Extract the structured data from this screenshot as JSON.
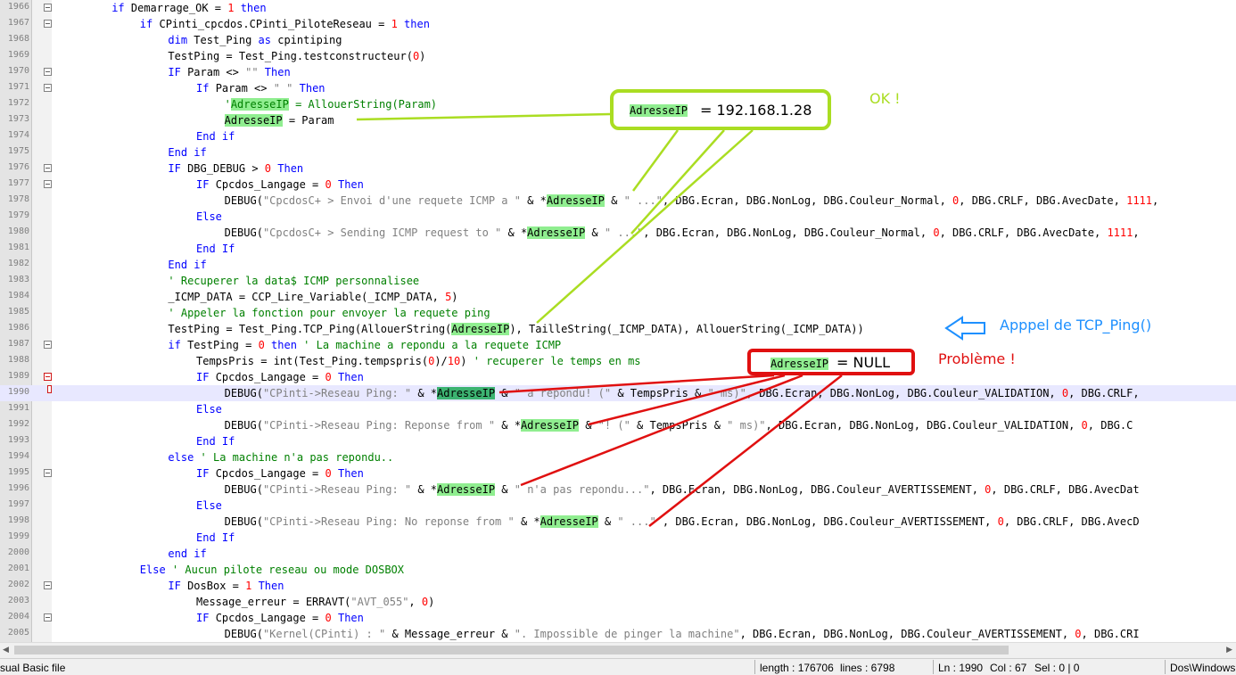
{
  "editor": {
    "lines": [
      {
        "num": "1966",
        "indent": 8,
        "fold": "open",
        "parts": [
          [
            "kw",
            "if "
          ],
          [
            "",
            "Demarrage_OK = "
          ],
          [
            "num",
            "1"
          ],
          [
            "kw",
            " then"
          ]
        ]
      },
      {
        "num": "1967",
        "indent": 12,
        "fold": "open",
        "parts": [
          [
            "kw",
            "if "
          ],
          [
            "",
            "CPinti_cpcdos.CPinti_PiloteReseau = "
          ],
          [
            "num",
            "1"
          ],
          [
            "kw",
            " then"
          ]
        ]
      },
      {
        "num": "1968",
        "indent": 16,
        "fold": "",
        "parts": [
          [
            "kw",
            "dim "
          ],
          [
            "",
            "Test_Ping "
          ],
          [
            "kw",
            "as "
          ],
          [
            "",
            "cpintiping"
          ]
        ]
      },
      {
        "num": "1969",
        "indent": 16,
        "fold": "",
        "parts": [
          [
            "",
            "TestPing = Test_Ping.testconstructeur("
          ],
          [
            "num",
            "0"
          ],
          [
            "",
            ")"
          ]
        ]
      },
      {
        "num": "1970",
        "indent": 16,
        "fold": "open",
        "parts": [
          [
            "kw",
            "IF "
          ],
          [
            "",
            "Param <> "
          ],
          [
            "str",
            "\"\""
          ],
          [
            "kw",
            " Then"
          ]
        ]
      },
      {
        "num": "1971",
        "indent": 20,
        "fold": "open",
        "parts": [
          [
            "kw",
            "If "
          ],
          [
            "",
            "Param <> "
          ],
          [
            "str",
            "\" \""
          ],
          [
            "kw",
            " Then"
          ]
        ]
      },
      {
        "num": "1972",
        "indent": 24,
        "fold": "",
        "parts": [
          [
            "cmt",
            "'"
          ],
          [
            "hlc",
            "AdresseIP"
          ],
          [
            "cmt",
            " = AllouerString(Param)"
          ]
        ]
      },
      {
        "num": "1973",
        "indent": 24,
        "fold": "",
        "parts": [
          [
            "hl",
            "AdresseIP"
          ],
          [
            "",
            " = Param"
          ]
        ]
      },
      {
        "num": "1974",
        "indent": 20,
        "fold": "end",
        "parts": [
          [
            "kw",
            "End if"
          ]
        ]
      },
      {
        "num": "1975",
        "indent": 16,
        "fold": "end",
        "parts": [
          [
            "kw",
            "End if"
          ]
        ]
      },
      {
        "num": "1976",
        "indent": 16,
        "fold": "open",
        "parts": [
          [
            "kw",
            "IF "
          ],
          [
            "",
            "DBG_DEBUG > "
          ],
          [
            "num",
            "0"
          ],
          [
            "kw",
            " Then"
          ]
        ]
      },
      {
        "num": "1977",
        "indent": 20,
        "fold": "open",
        "parts": [
          [
            "kw",
            "IF "
          ],
          [
            "",
            "Cpcdos_Langage = "
          ],
          [
            "num",
            "0"
          ],
          [
            "kw",
            " Then"
          ]
        ]
      },
      {
        "num": "1978",
        "indent": 24,
        "fold": "",
        "parts": [
          [
            "",
            "DEBUG("
          ],
          [
            "str",
            "\"CpcdosC+ > Envoi d'une requete ICMP a \""
          ],
          [
            "",
            " & *"
          ],
          [
            "hl",
            "AdresseIP"
          ],
          [
            "",
            " & "
          ],
          [
            "str",
            "\" ...\""
          ],
          [
            "",
            ", DBG.Ecran, DBG.NonLog, DBG.Couleur_Normal, "
          ],
          [
            "num",
            "0"
          ],
          [
            "",
            ", DBG.CRLF, DBG.AvecDate, "
          ],
          [
            "num",
            "1111"
          ],
          [
            "",
            ", "
          ]
        ]
      },
      {
        "num": "1979",
        "indent": 20,
        "fold": "mid",
        "parts": [
          [
            "kw",
            "Else"
          ]
        ]
      },
      {
        "num": "1980",
        "indent": 24,
        "fold": "",
        "parts": [
          [
            "",
            "DEBUG("
          ],
          [
            "str",
            "\"CpcdosC+ > Sending ICMP request to \""
          ],
          [
            "",
            " & *"
          ],
          [
            "hl",
            "AdresseIP"
          ],
          [
            "",
            " & "
          ],
          [
            "str",
            "\" ...\""
          ],
          [
            "",
            ", DBG.Ecran, DBG.NonLog, DBG.Couleur_Normal, "
          ],
          [
            "num",
            "0"
          ],
          [
            "",
            ", DBG.CRLF, DBG.AvecDate, "
          ],
          [
            "num",
            "1111"
          ],
          [
            "",
            ", "
          ]
        ]
      },
      {
        "num": "1981",
        "indent": 20,
        "fold": "end",
        "parts": [
          [
            "kw",
            "End If"
          ]
        ]
      },
      {
        "num": "1982",
        "indent": 16,
        "fold": "end",
        "parts": [
          [
            "kw",
            "End if"
          ]
        ]
      },
      {
        "num": "1983",
        "indent": 16,
        "fold": "",
        "parts": [
          [
            "cmt",
            "' Recuperer la data$ ICMP personnalisee"
          ]
        ]
      },
      {
        "num": "1984",
        "indent": 16,
        "fold": "",
        "parts": [
          [
            "",
            "_ICMP_DATA = CCP_Lire_Variable(_ICMP_DATA, "
          ],
          [
            "num",
            "5"
          ],
          [
            "",
            ")"
          ]
        ]
      },
      {
        "num": "1985",
        "indent": 16,
        "fold": "",
        "parts": [
          [
            "cmt",
            "' Appeler la fonction pour envoyer la requete ping"
          ]
        ]
      },
      {
        "num": "1986",
        "indent": 16,
        "fold": "",
        "parts": [
          [
            "",
            "TestPing = Test_Ping.TCP_Ping(AllouerString("
          ],
          [
            "hl",
            "AdresseIP"
          ],
          [
            "",
            "), TailleString(_ICMP_DATA), AllouerString(_ICMP_DATA))"
          ]
        ]
      },
      {
        "num": "1987",
        "indent": 16,
        "fold": "open",
        "parts": [
          [
            "kw",
            "if "
          ],
          [
            "",
            "TestPing = "
          ],
          [
            "num",
            "0"
          ],
          [
            "kw",
            " then "
          ],
          [
            "cmt",
            "' La machine a repondu a la requete ICMP"
          ]
        ]
      },
      {
        "num": "1988",
        "indent": 20,
        "fold": "",
        "parts": [
          [
            "",
            "TempsPris = int(Test_Ping.tempspris("
          ],
          [
            "num",
            "0"
          ],
          [
            "",
            ")/"
          ],
          [
            "num",
            "10"
          ],
          [
            "",
            ") "
          ],
          [
            "cmt",
            "' recuperer le temps en ms"
          ]
        ]
      },
      {
        "num": "1989",
        "indent": 20,
        "fold": "red",
        "parts": [
          [
            "kw",
            "IF "
          ],
          [
            "",
            "Cpcdos_Langage = "
          ],
          [
            "num",
            "0"
          ],
          [
            "kw",
            " Then"
          ]
        ]
      },
      {
        "num": "1990",
        "indent": 24,
        "fold": "joint",
        "current": true,
        "parts": [
          [
            "",
            "DEBUG("
          ],
          [
            "str",
            "\"CPinti->Reseau Ping: \""
          ],
          [
            "",
            " & *"
          ],
          [
            "hl2",
            "AdresseIP"
          ],
          [
            "",
            " & "
          ],
          [
            "str",
            "\" a repondu! (\""
          ],
          [
            "",
            " & TempsPris & "
          ],
          [
            "str",
            "\" ms)\""
          ],
          [
            "",
            ", DBG.Ecran, DBG.NonLog, DBG.Couleur_VALIDATION, "
          ],
          [
            "num",
            "0"
          ],
          [
            "",
            ", DBG.CRLF, "
          ]
        ]
      },
      {
        "num": "1991",
        "indent": 20,
        "fold": "mid",
        "parts": [
          [
            "kw",
            "Else"
          ]
        ]
      },
      {
        "num": "1992",
        "indent": 24,
        "fold": "",
        "parts": [
          [
            "",
            "DEBUG("
          ],
          [
            "str",
            "\"CPinti->Reseau Ping: Reponse from \""
          ],
          [
            "",
            " & *"
          ],
          [
            "hl",
            "AdresseIP"
          ],
          [
            "",
            " & "
          ],
          [
            "str",
            "\"! (\""
          ],
          [
            "",
            " & TempsPris & "
          ],
          [
            "str",
            "\" ms)\""
          ],
          [
            "",
            ", DBG.Ecran, DBG.NonLog, DBG.Couleur_VALIDATION, "
          ],
          [
            "num",
            "0"
          ],
          [
            "",
            ", DBG.C"
          ]
        ]
      },
      {
        "num": "1993",
        "indent": 20,
        "fold": "end",
        "parts": [
          [
            "kw",
            "End If"
          ]
        ]
      },
      {
        "num": "1994",
        "indent": 16,
        "fold": "mid",
        "parts": [
          [
            "kw",
            "else "
          ],
          [
            "cmt",
            "' La machine n'a pas repondu.."
          ]
        ]
      },
      {
        "num": "1995",
        "indent": 20,
        "fold": "open",
        "parts": [
          [
            "kw",
            "IF "
          ],
          [
            "",
            "Cpcdos_Langage = "
          ],
          [
            "num",
            "0"
          ],
          [
            "kw",
            " Then"
          ]
        ]
      },
      {
        "num": "1996",
        "indent": 24,
        "fold": "",
        "parts": [
          [
            "",
            "DEBUG("
          ],
          [
            "str",
            "\"CPinti->Reseau Ping: \""
          ],
          [
            "",
            " & *"
          ],
          [
            "hl",
            "AdresseIP"
          ],
          [
            "",
            " & "
          ],
          [
            "str",
            "\" n'a pas repondu...\""
          ],
          [
            "",
            ", DBG.Ecran, DBG.NonLog, DBG.Couleur_AVERTISSEMENT, "
          ],
          [
            "num",
            "0"
          ],
          [
            "",
            ", DBG.CRLF, DBG.AvecDat"
          ]
        ]
      },
      {
        "num": "1997",
        "indent": 20,
        "fold": "mid",
        "parts": [
          [
            "kw",
            "Else"
          ]
        ]
      },
      {
        "num": "1998",
        "indent": 24,
        "fold": "",
        "parts": [
          [
            "",
            "DEBUG("
          ],
          [
            "str",
            "\"CPinti->Reseau Ping: No reponse from \""
          ],
          [
            "",
            " & *"
          ],
          [
            "hl",
            "AdresseIP"
          ],
          [
            "",
            " & "
          ],
          [
            "str",
            "\" ...\""
          ],
          [
            "",
            " , DBG.Ecran, DBG.NonLog, DBG.Couleur_AVERTISSEMENT, "
          ],
          [
            "num",
            "0"
          ],
          [
            "",
            ", DBG.CRLF, DBG.AvecD"
          ]
        ]
      },
      {
        "num": "1999",
        "indent": 20,
        "fold": "end",
        "parts": [
          [
            "kw",
            "End If"
          ]
        ]
      },
      {
        "num": "2000",
        "indent": 16,
        "fold": "end",
        "parts": [
          [
            "kw",
            "end if"
          ]
        ]
      },
      {
        "num": "2001",
        "indent": 12,
        "fold": "mid",
        "parts": [
          [
            "kw",
            "Else "
          ],
          [
            "cmt",
            "' Aucun pilote reseau ou mode DOSBOX"
          ]
        ]
      },
      {
        "num": "2002",
        "indent": 16,
        "fold": "open",
        "parts": [
          [
            "kw",
            "IF "
          ],
          [
            "",
            "DosBox = "
          ],
          [
            "num",
            "1"
          ],
          [
            "kw",
            " Then"
          ]
        ]
      },
      {
        "num": "2003",
        "indent": 20,
        "fold": "",
        "parts": [
          [
            "",
            "Message_erreur = ERRAVT("
          ],
          [
            "str",
            "\"AVT_055\""
          ],
          [
            "",
            ", "
          ],
          [
            "num",
            "0"
          ],
          [
            "",
            ")"
          ]
        ]
      },
      {
        "num": "2004",
        "indent": 20,
        "fold": "open",
        "parts": [
          [
            "kw",
            "IF "
          ],
          [
            "",
            "Cpcdos_Langage = "
          ],
          [
            "num",
            "0"
          ],
          [
            "kw",
            " Then"
          ]
        ]
      },
      {
        "num": "2005",
        "indent": 24,
        "fold": "",
        "parts": [
          [
            "",
            "DEBUG("
          ],
          [
            "str",
            "\"Kernel(CPinti) : \""
          ],
          [
            "",
            " & Message_erreur & "
          ],
          [
            "str",
            "\". Impossible de pinger la machine\""
          ],
          [
            "",
            ", DBG.Ecran, DBG.NonLog, DBG.Couleur_AVERTISSEMENT, "
          ],
          [
            "num",
            "0"
          ],
          [
            "",
            ", DBG.CRI"
          ]
        ]
      }
    ]
  },
  "annotations": {
    "ok_box": {
      "label": "AdresseIP",
      "value": "= 192.168.1.28"
    },
    "ok_text": "OK !",
    "call_text": "Apppel de TCP_Ping()",
    "null_box": {
      "label": "AdresseIP",
      "value": "=  NULL"
    },
    "problem_text": "Problème !",
    "colors": {
      "green": "#aadd22",
      "blue": "#1e90ff",
      "red": "#e01010"
    }
  },
  "statusbar": {
    "file_type": "sual Basic file",
    "length": "length : 176706",
    "lines": "lines : 6798",
    "ln": "Ln : 1990",
    "col": "Col : 67",
    "sel": "Sel : 0 | 0",
    "eol": "Dos\\Windows"
  },
  "scrollbar": {
    "left_arrow": "◀",
    "right_arrow": "▶"
  }
}
